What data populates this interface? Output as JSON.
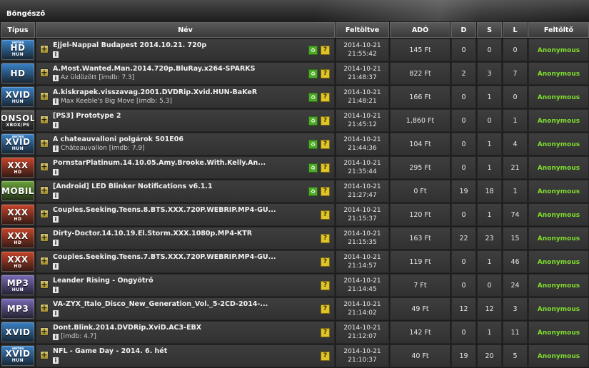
{
  "window": {
    "tab_title": "Böngésző"
  },
  "columns": [
    "Típus",
    "Név",
    "Feltöltve",
    "ADÓ",
    "D",
    "S",
    "L",
    "Feltöltő"
  ],
  "rows": [
    {
      "type": {
        "top": "series",
        "main": "HD",
        "sub": "HUN",
        "color": "#3a82c8"
      },
      "name": "Éjjel-Nappal Budapest 2014.10.21. 720p",
      "sub": "",
      "imdb": "",
      "green": true,
      "date": "2014-10-21",
      "time": "21:55:42",
      "ado": "145 Ft",
      "d": "0",
      "s": "0",
      "l": "0",
      "uploader": "Anonymous"
    },
    {
      "type": {
        "top": "",
        "main": "HD",
        "sub": "",
        "color": "#3a82c8"
      },
      "name": "A.Most.Wanted.Man.2014.720p.BluRay.x264-SPARKS",
      "sub": "Az üldözött",
      "imdb": "[imdb: 7.3]",
      "green": true,
      "date": "2014-10-21",
      "time": "21:48:37",
      "ado": "822 Ft",
      "d": "2",
      "s": "3",
      "l": "7",
      "uploader": "Anonymous"
    },
    {
      "type": {
        "top": "",
        "main": "XVID",
        "sub": "HUN",
        "color": "#3a82c8"
      },
      "name": "A.kiskrapek.visszavag.2001.DVDRip.Xvid.HUN-BaKeR",
      "sub": "Max Keeble's Big Move",
      "imdb": "[imdb: 5.3]",
      "green": true,
      "date": "2014-10-21",
      "time": "21:48:21",
      "ado": "166 Ft",
      "d": "0",
      "s": "1",
      "l": "0",
      "uploader": "Anonymous"
    },
    {
      "type": {
        "top": "",
        "main": "CONSOLE",
        "sub": "XBOX/PS",
        "color": "#5a5a5a"
      },
      "name": "[PS3] Prototype 2",
      "sub": "",
      "imdb": "",
      "green": true,
      "date": "2014-10-21",
      "time": "21:45:12",
      "ado": "1,860 Ft",
      "d": "0",
      "s": "0",
      "l": "1",
      "uploader": "Anonymous"
    },
    {
      "type": {
        "top": "series",
        "main": "XVID",
        "sub": "HUN",
        "color": "#3a82c8"
      },
      "name": "A chateauvalloni polgárok S01E06",
      "sub": "Châteauvallon",
      "imdb": "[imdb: 7.9]",
      "green": true,
      "date": "2014-10-21",
      "time": "21:44:36",
      "ado": "104 Ft",
      "d": "0",
      "s": "1",
      "l": "4",
      "uploader": "Anonymous"
    },
    {
      "type": {
        "top": "",
        "main": "XXX",
        "sub": "HD",
        "color": "#c8452a"
      },
      "name": "PornstarPlatinum.14.10.05.Amy.Brooke.With.Kelly.An...",
      "sub": "",
      "imdb": "",
      "green": true,
      "date": "2014-10-21",
      "time": "21:35:44",
      "ado": "295 Ft",
      "d": "0",
      "s": "1",
      "l": "21",
      "uploader": "Anonymous"
    },
    {
      "type": {
        "top": "",
        "main": "MOBIL",
        "sub": "",
        "color": "#6aa43a"
      },
      "name": "[Android] LED Blinker Notifications v6.1.1",
      "sub": "",
      "imdb": "",
      "green": true,
      "date": "2014-10-21",
      "time": "21:27:47",
      "ado": "0 Ft",
      "d": "19",
      "s": "18",
      "l": "1",
      "uploader": "Anonymous"
    },
    {
      "type": {
        "top": "",
        "main": "XXX",
        "sub": "HD",
        "color": "#c8452a"
      },
      "name": "Couples.Seeking.Teens.8.BTS.XXX.720P.WEBRIP.MP4-GU...",
      "sub": "",
      "imdb": "",
      "green": false,
      "date": "2014-10-21",
      "time": "21:15:37",
      "ado": "120 Ft",
      "d": "0",
      "s": "1",
      "l": "74",
      "uploader": "Anonymous"
    },
    {
      "type": {
        "top": "",
        "main": "XXX",
        "sub": "HD",
        "color": "#c8452a"
      },
      "name": "Dirty-Doctor.14.10.19.El.Storm.XXX.1080p.MP4-KTR",
      "sub": "",
      "imdb": "",
      "green": false,
      "date": "2014-10-21",
      "time": "21:15:35",
      "ado": "163 Ft",
      "d": "22",
      "s": "23",
      "l": "15",
      "uploader": "Anonymous"
    },
    {
      "type": {
        "top": "",
        "main": "XXX",
        "sub": "HD",
        "color": "#c8452a"
      },
      "name": "Couples.Seeking.Teens.7.BTS.XXX.720P.WEBRIP.MP4-GU...",
      "sub": "",
      "imdb": "",
      "green": false,
      "date": "2014-10-21",
      "time": "21:14:57",
      "ado": "119 Ft",
      "d": "0",
      "s": "1",
      "l": "46",
      "uploader": "Anonymous"
    },
    {
      "type": {
        "top": "",
        "main": "MP3",
        "sub": "HUN",
        "color": "#7a6ab8"
      },
      "name": "Leander Rising - Öngyötrő",
      "sub": "",
      "imdb": "",
      "green": false,
      "date": "2014-10-21",
      "time": "21:14:45",
      "ado": "7 Ft",
      "d": "0",
      "s": "0",
      "l": "24",
      "uploader": "Anonymous"
    },
    {
      "type": {
        "top": "",
        "main": "MP3",
        "sub": "",
        "color": "#7a6ab8"
      },
      "name": "VA-ZYX_Italo_Disco_New_Generation_Vol._5-2CD-2014-...",
      "sub": "",
      "imdb": "",
      "green": false,
      "date": "2014-10-21",
      "time": "21:14:02",
      "ado": "49 Ft",
      "d": "12",
      "s": "12",
      "l": "3",
      "uploader": "Anonymous"
    },
    {
      "type": {
        "top": "",
        "main": "XVID",
        "sub": "",
        "color": "#3a82c8"
      },
      "name": "Dont.Blink.2014.DVDRip.XviD.AC3-EBX",
      "sub": "",
      "imdb": "[imdb: 4.7]",
      "green": false,
      "date": "2014-10-21",
      "time": "21:12:07",
      "ado": "142 Ft",
      "d": "0",
      "s": "1",
      "l": "11",
      "uploader": "Anonymous"
    },
    {
      "type": {
        "top": "series",
        "main": "XVID",
        "sub": "HUN",
        "color": "#3a82c8"
      },
      "name": "NFL - Game Day - 2014. 6. hét",
      "sub": "",
      "imdb": "",
      "green": false,
      "date": "2014-10-21",
      "time": "21:10:37",
      "ado": "40 Ft",
      "d": "19",
      "s": "20",
      "l": "5",
      "uploader": "Anonymous"
    }
  ]
}
